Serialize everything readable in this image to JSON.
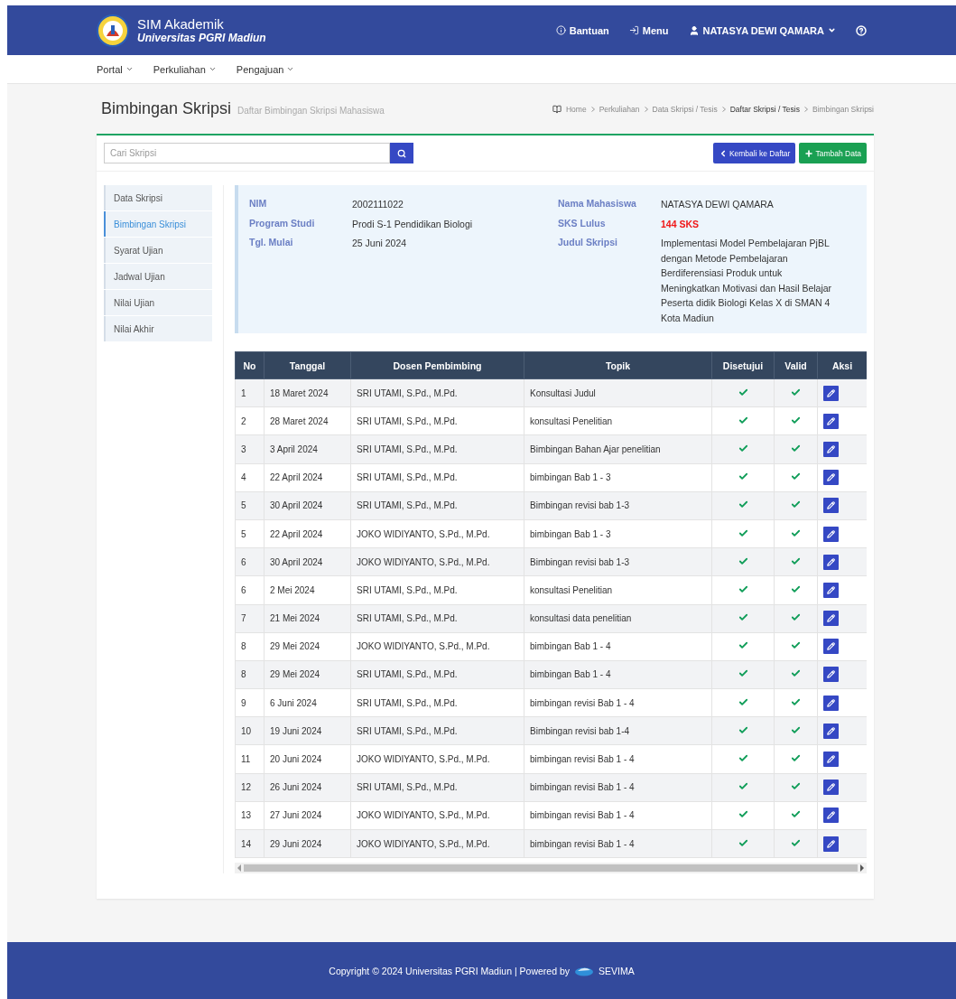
{
  "header": {
    "app_name": "SIM Akademik",
    "university": "Universitas PGRI Madiun",
    "links": [
      {
        "label": "Bantuan",
        "kind": "info"
      },
      {
        "label": "Menu",
        "kind": "login"
      }
    ],
    "user": "NATASYA DEWI QAMARA"
  },
  "nav": [
    "Portal",
    "Perkuliahan",
    "Pengajuan"
  ],
  "page": {
    "title": "Bimbingan Skripsi",
    "subtitle": "Daftar Bimbingan Skripsi Mahasiswa"
  },
  "breadcrumb": [
    {
      "label": "Home",
      "current": false
    },
    {
      "label": "Perkuliahan",
      "current": false
    },
    {
      "label": "Data Skripsi / Tesis",
      "current": false
    },
    {
      "label": "Daftar Skripsi / Tesis",
      "current": true
    },
    {
      "label": "Bimbingan Skripsi",
      "current": false
    }
  ],
  "search": {
    "placeholder": "Cari Skripsi"
  },
  "buttons": [
    {
      "label": "Kembali ke Daftar",
      "kind": "back"
    },
    {
      "label": "Tambah Data",
      "kind": "add"
    }
  ],
  "sidebar": [
    {
      "label": "Data Skripsi",
      "selected": false
    },
    {
      "label": "Bimbingan Skripsi",
      "selected": true
    },
    {
      "label": "Syarat Ujian",
      "selected": false
    },
    {
      "label": "Jadwal Ujian",
      "selected": false
    },
    {
      "label": "Nilai Ujian",
      "selected": false
    },
    {
      "label": "Nilai Akhir",
      "selected": false
    }
  ],
  "info_left": [
    {
      "label": "NIM",
      "value": "2002111022"
    },
    {
      "label": "Program Studi",
      "value": "Prodi S-1 Pendidikan Biologi"
    },
    {
      "label": "Tgl. Mulai",
      "value": "25 Juni 2024"
    }
  ],
  "info_right": [
    {
      "label": "Nama Mahasiswa",
      "value": "NATASYA DEWI QAMARA",
      "kind": "plain"
    },
    {
      "label": "SKS Lulus",
      "value": "144 SKS",
      "kind": "highlight"
    },
    {
      "label": "Judul Skripsi",
      "value": "Implementasi Model Pembelajaran PjBL dengan Metode Pembelajaran Berdiferensiasi Produk untuk Meningkatkan Motivasi dan Hasil Belajar Peserta didik Biologi Kelas X di SMAN 4 Kota Madiun",
      "kind": "plain"
    }
  ],
  "table": {
    "columns": [
      "No",
      "Tanggal",
      "Dosen Pembimbing",
      "Topik",
      "Disetujui",
      "Valid",
      "Aksi"
    ],
    "rows": [
      {
        "no": "1",
        "date": "18 Maret 2024",
        "lecturer": "SRI UTAMI, S.Pd., M.Pd.",
        "topic": "Konsultasi Judul",
        "approved": true,
        "valid": true
      },
      {
        "no": "2",
        "date": "28 Maret 2024",
        "lecturer": "SRI UTAMI, S.Pd., M.Pd.",
        "topic": "konsultasi Penelitian",
        "approved": true,
        "valid": true
      },
      {
        "no": "3",
        "date": "3 April 2024",
        "lecturer": "SRI UTAMI, S.Pd., M.Pd.",
        "topic": "Bimbingan Bahan Ajar penelitian",
        "approved": true,
        "valid": true
      },
      {
        "no": "4",
        "date": "22 April 2024",
        "lecturer": "SRI UTAMI, S.Pd., M.Pd.",
        "topic": "bimbingan Bab 1 - 3",
        "approved": true,
        "valid": true
      },
      {
        "no": "5",
        "date": "30 April 2024",
        "lecturer": "SRI UTAMI, S.Pd., M.Pd.",
        "topic": "Bimbingan revisi bab 1-3",
        "approved": true,
        "valid": true
      },
      {
        "no": "5",
        "date": "22 April 2024",
        "lecturer": "JOKO WIDIYANTO, S.Pd., M.Pd.",
        "topic": "bimbingan Bab 1 - 3",
        "approved": true,
        "valid": true
      },
      {
        "no": "6",
        "date": "30 April 2024",
        "lecturer": "JOKO WIDIYANTO, S.Pd., M.Pd.",
        "topic": "Bimbingan revisi bab 1-3",
        "approved": true,
        "valid": true
      },
      {
        "no": "6",
        "date": "2 Mei 2024",
        "lecturer": "SRI UTAMI, S.Pd., M.Pd.",
        "topic": "konsultasi Penelitian",
        "approved": true,
        "valid": true
      },
      {
        "no": "7",
        "date": "21 Mei 2024",
        "lecturer": "SRI UTAMI, S.Pd., M.Pd.",
        "topic": "konsultasi data penelitian",
        "approved": true,
        "valid": true
      },
      {
        "no": "8",
        "date": "29 Mei 2024",
        "lecturer": "JOKO WIDIYANTO, S.Pd., M.Pd.",
        "topic": "bimbingan Bab 1 - 4",
        "approved": true,
        "valid": true
      },
      {
        "no": "8",
        "date": "29 Mei 2024",
        "lecturer": "SRI UTAMI, S.Pd., M.Pd.",
        "topic": "bimbingan Bab 1 - 4",
        "approved": true,
        "valid": true
      },
      {
        "no": "9",
        "date": "6 Juni 2024",
        "lecturer": "SRI UTAMI, S.Pd., M.Pd.",
        "topic": "bimbingan revisi Bab 1 - 4",
        "approved": true,
        "valid": true
      },
      {
        "no": "10",
        "date": "19 Juni 2024",
        "lecturer": "SRI UTAMI, S.Pd., M.Pd.",
        "topic": "Bimbingan revisi bab 1-4",
        "approved": true,
        "valid": true
      },
      {
        "no": "11",
        "date": "20 Juni 2024",
        "lecturer": "JOKO WIDIYANTO, S.Pd., M.Pd.",
        "topic": "bimbingan revisi Bab 1 - 4",
        "approved": true,
        "valid": true
      },
      {
        "no": "12",
        "date": "26 Juni 2024",
        "lecturer": "SRI UTAMI, S.Pd., M.Pd.",
        "topic": "bimbingan revisi Bab 1 - 4",
        "approved": true,
        "valid": true
      },
      {
        "no": "13",
        "date": "27 Juni 2024",
        "lecturer": "JOKO WIDIYANTO, S.Pd., M.Pd.",
        "topic": "bimbingan revisi Bab 1 - 4",
        "approved": true,
        "valid": true
      },
      {
        "no": "14",
        "date": "29 Juni 2024",
        "lecturer": "JOKO WIDIYANTO, S.Pd., M.Pd.",
        "topic": "bimbingan revisi Bab 1 - 4",
        "approved": true,
        "valid": true
      }
    ]
  },
  "footer": {
    "copyright": "Copyright © 2024 Universitas PGRI Madiun | Powered by",
    "brand": "SEVIMA"
  }
}
